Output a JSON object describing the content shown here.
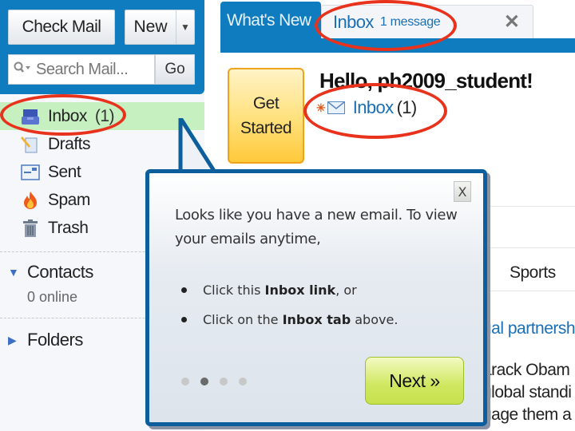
{
  "sidebar": {
    "check_mail_label": "Check Mail",
    "new_label": "New",
    "search_placeholder": "Search Mail...",
    "go_label": "Go",
    "folders": [
      {
        "label": "Inbox",
        "count": "(1)",
        "icon": "inbox-icon",
        "active": true
      },
      {
        "label": "Drafts",
        "icon": "drafts-icon"
      },
      {
        "label": "Sent",
        "icon": "sent-icon"
      },
      {
        "label": "Spam",
        "icon": "spam-icon"
      },
      {
        "label": "Trash",
        "icon": "trash-icon"
      }
    ],
    "contacts": {
      "label": "Contacts",
      "status": "0 online",
      "expanded": true
    },
    "folders_section": {
      "label": "Folders",
      "expanded": false
    }
  },
  "tabs": {
    "whats_new": "What's New",
    "inbox": {
      "label": "Inbox",
      "sublabel": "1 message",
      "close": "✕"
    }
  },
  "welcome": {
    "get_started": "Get Started",
    "greeting": "Hello, ph2009_student!",
    "inbox_link": "Inbox",
    "inbox_count": "(1)"
  },
  "content": {
    "sports_tab": "Sports",
    "headline_fragment": "ual partnersh",
    "text_lines": [
      "arack Obam",
      "global standi",
      "gage them a"
    ]
  },
  "popup": {
    "close": "X",
    "message": "Looks like you have a new email. To view your emails anytime,",
    "items": [
      {
        "prefix": "Click this ",
        "bold": "Inbox link",
        "suffix": ", or"
      },
      {
        "prefix": "Click on the ",
        "bold": "Inbox tab",
        "suffix": " above."
      }
    ],
    "page_current": 2,
    "page_total": 4,
    "next_label": "Next »"
  },
  "colors": {
    "brand_blue": "#0f7cc0",
    "popup_border": "#0c5f9c",
    "highlight_green": "#c6f0c0",
    "annotation_red": "#e8321c",
    "next_green": "#cfe760",
    "get_started_orange": "#ffc93a"
  }
}
